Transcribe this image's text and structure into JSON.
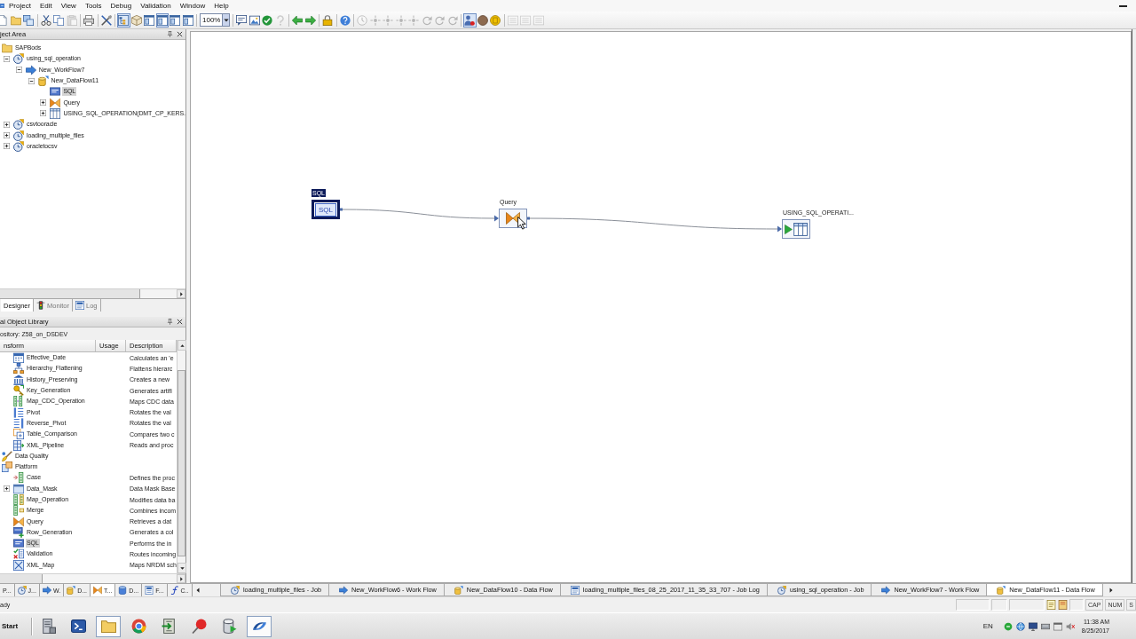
{
  "menu": [
    "Project",
    "Edit",
    "View",
    "Tools",
    "Debug",
    "Validation",
    "Window",
    "Help"
  ],
  "toolbar": {
    "items": [
      {
        "kind": "page",
        "pressed": false,
        "disabled": false
      },
      {
        "kind": "folder",
        "pressed": false,
        "disabled": false
      },
      {
        "kind": "windows",
        "pressed": false,
        "disabled": false
      },
      {
        "kind": "separator"
      },
      {
        "kind": "scissors",
        "pressed": false,
        "disabled": false
      },
      {
        "kind": "copy",
        "pressed": false,
        "disabled": false
      },
      {
        "kind": "paste",
        "pressed": false,
        "disabled": true
      },
      {
        "kind": "separator"
      },
      {
        "kind": "printer",
        "pressed": false,
        "disabled": false
      },
      {
        "kind": "separator"
      },
      {
        "kind": "tools",
        "pressed": false,
        "disabled": false
      },
      {
        "kind": "separator"
      },
      {
        "kind": "tree",
        "pressed": true,
        "disabled": false
      },
      {
        "kind": "box",
        "pressed": false,
        "disabled": false
      },
      {
        "kind": "panel",
        "pressed": false,
        "disabled": false
      },
      {
        "kind": "panel",
        "pressed": true,
        "disabled": false
      },
      {
        "kind": "panel",
        "pressed": false,
        "disabled": false
      },
      {
        "kind": "panel",
        "pressed": false,
        "disabled": false
      },
      {
        "kind": "separator"
      },
      {
        "kind": "zoom",
        "value": "100%"
      },
      {
        "kind": "separator"
      },
      {
        "kind": "comment",
        "pressed": false,
        "disabled": false
      },
      {
        "kind": "image",
        "pressed": false,
        "disabled": false
      },
      {
        "kind": "check",
        "pressed": false,
        "disabled": false
      },
      {
        "kind": "question",
        "pressed": false,
        "disabled": true
      },
      {
        "kind": "separator"
      },
      {
        "kind": "back",
        "pressed": false,
        "disabled": false
      },
      {
        "kind": "forward",
        "pressed": false,
        "disabled": false
      },
      {
        "kind": "separator"
      },
      {
        "kind": "lock",
        "pressed": false,
        "disabled": false
      },
      {
        "kind": "separator"
      },
      {
        "kind": "help",
        "pressed": false,
        "disabled": false
      },
      {
        "kind": "separator"
      },
      {
        "kind": "clock",
        "pressed": false,
        "disabled": true
      },
      {
        "kind": "step",
        "pressed": false,
        "disabled": true
      },
      {
        "kind": "step",
        "pressed": false,
        "disabled": true
      },
      {
        "kind": "step",
        "pressed": false,
        "disabled": true
      },
      {
        "kind": "step",
        "pressed": false,
        "disabled": true
      },
      {
        "kind": "refresh",
        "pressed": false,
        "disabled": true
      },
      {
        "kind": "refresh",
        "pressed": false,
        "disabled": true
      },
      {
        "kind": "refresh",
        "pressed": false,
        "disabled": true
      },
      {
        "kind": "separator"
      },
      {
        "kind": "user",
        "pressed": true,
        "disabled": false
      },
      {
        "kind": "stop",
        "pressed": false,
        "disabled": false
      },
      {
        "kind": "coin",
        "pressed": false,
        "disabled": false
      },
      {
        "kind": "separator"
      },
      {
        "kind": "list",
        "pressed": false,
        "disabled": true
      },
      {
        "kind": "list",
        "pressed": false,
        "disabled": true
      },
      {
        "kind": "list",
        "pressed": false,
        "disabled": true
      }
    ]
  },
  "project_area": {
    "title": "ject Area",
    "tree": [
      {
        "label": "SAPBods",
        "kind": "folder",
        "selected": false,
        "children": [
          {
            "label": "using_sql_operation",
            "kind": "job",
            "expanded": true,
            "selected": false,
            "children": [
              {
                "label": "New_WorkFlow7",
                "kind": "workflow",
                "expanded": true,
                "selected": false,
                "children": [
                  {
                    "label": "New_DataFlow11",
                    "kind": "dataflow",
                    "expanded": true,
                    "selected": false,
                    "children": [
                      {
                        "label": "SQL",
                        "kind": "sql",
                        "selected": true
                      },
                      {
                        "label": "Query",
                        "kind": "query",
                        "expanded": false,
                        "selected": false
                      },
                      {
                        "label": "USING_SQL_OPERATION(DMT_CP_KERS.",
                        "kind": "table",
                        "expanded": false,
                        "selected": false
                      }
                    ]
                  }
                ]
              }
            ]
          },
          {
            "label": "csvtooracle",
            "kind": "job",
            "expanded": false,
            "selected": false
          },
          {
            "label": "loading_multiple_files",
            "kind": "job",
            "expanded": false,
            "selected": false
          },
          {
            "label": "oracletocsv",
            "kind": "job",
            "expanded": false,
            "selected": false
          }
        ]
      }
    ],
    "tabs": [
      {
        "label": "Designer",
        "selected": true
      },
      {
        "label": "Monitor",
        "kind": "monitor",
        "selected": false
      },
      {
        "label": "Log",
        "kind": "log",
        "selected": false
      }
    ]
  },
  "object_library": {
    "title": "al Object Library",
    "repository": "ository: Z58_on_DSDEV",
    "columns": [
      "nsform",
      "Usage",
      "Description"
    ],
    "rows": [
      {
        "kind": "continued",
        "children": [
          {
            "name": "Effective_Date",
            "kind": "date",
            "description": "Calculates an 'e",
            "selected": false
          },
          {
            "name": "Hierarchy_Flattening",
            "kind": "hierarchy",
            "description": "Flattens hierarc",
            "selected": false
          },
          {
            "name": "History_Preserving",
            "kind": "history",
            "description": "Creates a new",
            "selected": false
          },
          {
            "name": "Key_Generation",
            "kind": "key",
            "description": "Generates artifi",
            "selected": false
          },
          {
            "name": "Map_CDC_Operation",
            "kind": "cdc",
            "description": "Maps CDC data",
            "selected": false
          },
          {
            "name": "Pivot",
            "kind": "pivot",
            "description": "Rotates the val",
            "selected": false
          },
          {
            "name": "Reverse_Pivot",
            "kind": "reverse_pivot",
            "description": "Rotates the val",
            "selected": false
          },
          {
            "name": "Table_Comparison",
            "kind": "compare",
            "description": "Compares two c",
            "selected": false
          },
          {
            "name": "XML_Pipeline",
            "kind": "xml",
            "description": "Reads and proc",
            "selected": false
          }
        ]
      },
      {
        "name": "Data Quality",
        "kind": "quality",
        "selected": false
      },
      {
        "name": "Platform",
        "kind": "platform",
        "selected": false,
        "children": [
          {
            "name": "Case",
            "kind": "case",
            "description": "Defines the proc",
            "selected": false
          },
          {
            "name": "Data_Mask",
            "kind": "mask",
            "expanded": false,
            "description": "Data Mask Base",
            "selected": false
          },
          {
            "name": "Map_Operation",
            "kind": "map",
            "description": "Modifies data ba",
            "selected": false
          },
          {
            "name": "Merge",
            "kind": "merge",
            "description": "Combines incom",
            "selected": false
          },
          {
            "name": "Query",
            "kind": "query",
            "description": "Retrieves a dat",
            "selected": false
          },
          {
            "name": "Row_Generation",
            "kind": "rowgen",
            "description": "Generates a col",
            "selected": false
          },
          {
            "name": "SQL",
            "kind": "sql",
            "description": "Performs the in",
            "selected": true
          },
          {
            "name": "Validation",
            "kind": "validation",
            "description": "Routes incoming",
            "selected": false
          },
          {
            "name": "XML_Map",
            "kind": "xmlmap",
            "description": "Maps NRDM sch",
            "selected": false
          }
        ]
      }
    ],
    "tabs": [
      {
        "label": "P...",
        "selected": false
      },
      {
        "label": "J...",
        "kind": "job",
        "selected": false
      },
      {
        "label": "W.",
        "kind": "workflow",
        "selected": false
      },
      {
        "label": "D...",
        "kind": "dataflow",
        "selected": false
      },
      {
        "label": "T...",
        "kind": "query",
        "selected": true
      },
      {
        "label": "D...",
        "kind": "datastore",
        "selected": false
      },
      {
        "label": "F...",
        "kind": "format",
        "selected": false
      },
      {
        "label": "C..",
        "kind": "function",
        "selected": false
      }
    ]
  },
  "canvas": {
    "nodes": [
      {
        "kind": "sql",
        "label": "SQL",
        "icon_text": "SQL",
        "selected": true
      },
      {
        "kind": "query",
        "label": "Query",
        "selected": false
      },
      {
        "kind": "target",
        "label": "USING_SQL_OPERATI...",
        "selected": false
      }
    ]
  },
  "document_tabs": [
    {
      "label": "loading_multiple_files - Job",
      "kind": "job",
      "selected": false
    },
    {
      "label": "New_WorkFlow6 - Work Flow",
      "kind": "workflow",
      "selected": false
    },
    {
      "label": "New_DataFlow10 - Data Flow",
      "kind": "dataflow",
      "selected": false
    },
    {
      "label": "loading_multiple_files_08_25_2017_11_35_33_707 - Job Log",
      "kind": "log",
      "selected": false
    },
    {
      "label": "using_sql_operation - Job",
      "kind": "job",
      "selected": false
    },
    {
      "label": "New_WorkFlow7 - Work Flow",
      "kind": "workflow",
      "selected": false
    },
    {
      "label": "New_DataFlow11 - Data Flow",
      "kind": "dataflow",
      "selected": true
    }
  ],
  "status_bar": {
    "text": "ady",
    "indicators": [
      "CAP",
      "NUM",
      "S"
    ]
  },
  "taskbar": {
    "start": "Start",
    "apps": [
      {
        "kind": "server",
        "active": false
      },
      {
        "kind": "shell",
        "active": false
      },
      {
        "kind": "folder",
        "active": true
      },
      {
        "kind": "browser",
        "active": false
      },
      {
        "kind": "app",
        "active": false
      },
      {
        "kind": "pushpin",
        "active": false
      },
      {
        "kind": "database",
        "active": false
      },
      {
        "kind": "dataservices",
        "active": true
      }
    ],
    "language": "EN",
    "time": "11:38 AM",
    "date": "8/25/2017"
  }
}
